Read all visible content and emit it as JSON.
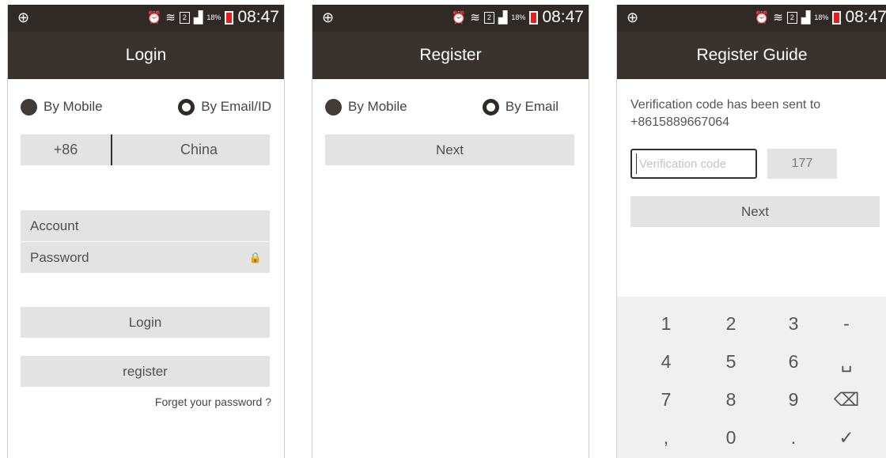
{
  "statusbar": {
    "time": "08:47",
    "battery": "18%",
    "sim": "2",
    "left_icon": "plus-circle-icon",
    "icons": [
      "alarm-icon",
      "wifi-icon",
      "signal-icon",
      "battery-charging-icon"
    ]
  },
  "login": {
    "title": "Login",
    "radio_mobile": "By Mobile",
    "radio_email": "By Email/ID",
    "country_code": "+86",
    "country_name": "China",
    "account_placeholder": "Account",
    "password_placeholder": "Password",
    "login_button": "Login",
    "register_button": "register",
    "forget_link": "Forget your password ?"
  },
  "register": {
    "title": "Register",
    "radio_mobile": "By Mobile",
    "radio_email": "By Email",
    "next_button": "Next"
  },
  "guide": {
    "title": "Register Guide",
    "message": "Verification code has been sent to +8615889667064",
    "code_placeholder": "Verification code",
    "countdown": "177",
    "next_button": "Next"
  },
  "keypad": {
    "keys": [
      "1",
      "2",
      "3",
      "-",
      "4",
      "5",
      "6",
      "␣",
      "7",
      "8",
      "9",
      "⌫",
      ",",
      "0",
      ".",
      "✓"
    ]
  },
  "colors": {
    "titlebar": "#3a332d",
    "statusbar": "#2f2a26",
    "field": "#e3e3e3",
    "battery_accent": "#e51d1d"
  }
}
